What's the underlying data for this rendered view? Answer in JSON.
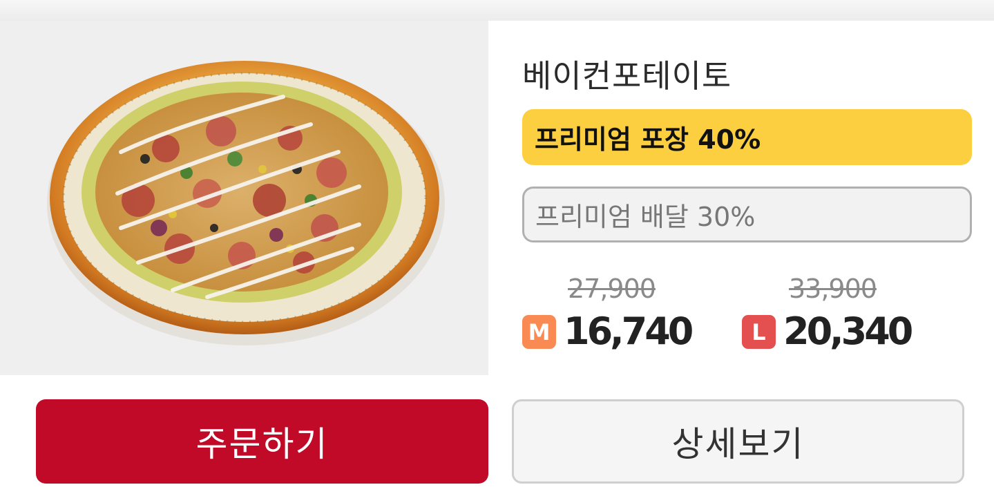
{
  "product": {
    "name": "베이컨포테이토"
  },
  "options": [
    {
      "label": "프리미엄 포장 40%",
      "selected": true
    },
    {
      "label": "프리미엄 배달 30%",
      "selected": false
    }
  ],
  "prices": [
    {
      "size": "M",
      "original": "27,900",
      "sale": "16,740",
      "badge_color": "#f98a54"
    },
    {
      "size": "L",
      "original": "33,900",
      "sale": "20,340",
      "badge_color": "#e4504f"
    }
  ],
  "buttons": {
    "order_label": "주문하기",
    "detail_label": "상세보기"
  },
  "colors": {
    "accent_red": "#c10a27",
    "selected_option": "#fbcf40"
  },
  "image": {
    "icon": "pizza-image"
  }
}
